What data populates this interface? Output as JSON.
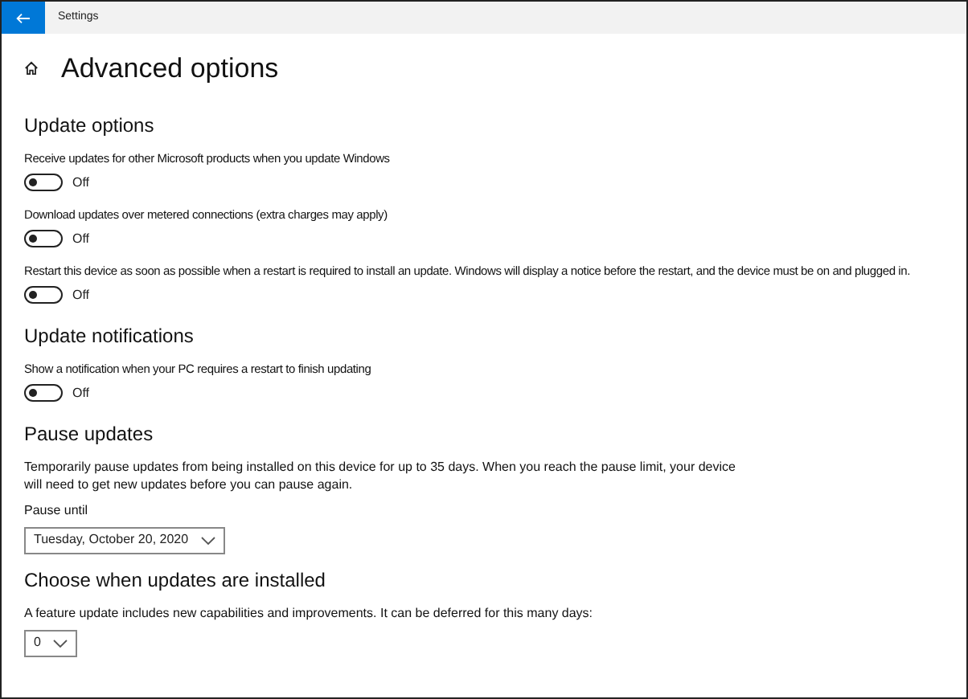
{
  "window": {
    "title": "Settings"
  },
  "page": {
    "title": "Advanced options"
  },
  "sections": [
    {
      "heading": "Update options",
      "items": [
        {
          "kind": "toggle",
          "label": "Receive updates for other Microsoft products when you update Windows",
          "on": false,
          "state_text": "Off"
        },
        {
          "kind": "toggle",
          "label": "Download updates over metered connections (extra charges may apply)",
          "on": false,
          "state_text": "Off"
        },
        {
          "kind": "toggle",
          "label": "Restart this device as soon as possible when a restart is required to install an update. Windows will display a notice before the restart, and the device must be on and plugged in.",
          "on": false,
          "state_text": "Off"
        }
      ]
    },
    {
      "heading": "Update notifications",
      "items": [
        {
          "kind": "toggle",
          "label": "Show a notification when your PC requires a restart to finish updating",
          "on": false,
          "state_text": "Off"
        }
      ]
    },
    {
      "heading": "Pause updates",
      "items": [
        {
          "kind": "text",
          "text": "Temporarily pause updates from being installed on this device for up to 35 days. When you reach the pause limit, your device will need to get new updates before you can pause again."
        },
        {
          "kind": "select",
          "label": "Pause until",
          "value": "Tuesday, October 20, 2020"
        }
      ]
    },
    {
      "heading": "Choose when updates are installed",
      "items": [
        {
          "kind": "text",
          "text": "A feature update includes new capabilities and improvements. It can be deferred for this many days:"
        },
        {
          "kind": "select",
          "value": "0"
        }
      ]
    }
  ]
}
